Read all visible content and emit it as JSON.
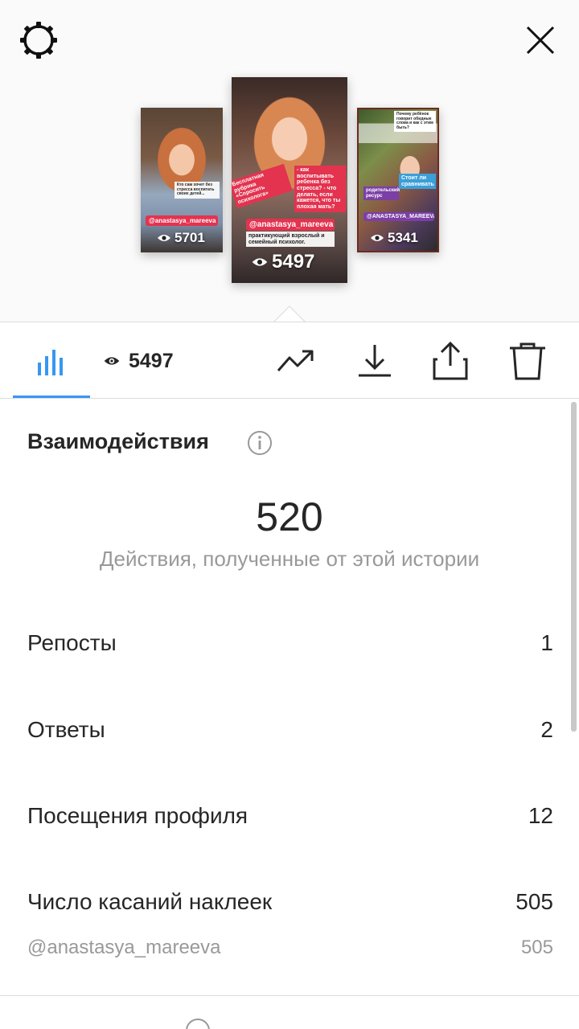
{
  "header": {
    "settings_icon": "settings-gear-icon",
    "close_icon": "close-icon"
  },
  "stories": [
    {
      "views": "5701",
      "handle": "@anastasya_mareeva",
      "caption": "Кто сам хочет без стресса воспитать своих детей..."
    },
    {
      "views": "5497",
      "handle": "@anastasya_mareeva",
      "rubric": "Бесплатная рубрика «Спросить психолога»",
      "questions": "- как воспитывать ребенка без стресса? - что делать, если кажется, что ты плохая мать?",
      "subtitle": "практикующий взрослый и семейный психолог."
    },
    {
      "views": "5341",
      "handle": "@ANASTASYA_MAREEVA",
      "headline": "Почему ребёнок говорит обидные слова и как с этим быть?",
      "resource": "родительский ресурс",
      "worth": "Стоит ли сравнивать"
    }
  ],
  "toolbar": {
    "views": "5497",
    "insights_icon": "bar-chart-icon",
    "eye_icon": "eye-icon",
    "trend_icon": "trending-up-icon",
    "download_icon": "download-icon",
    "share_icon": "share-icon",
    "delete_icon": "trash-icon"
  },
  "interactions": {
    "title": "Взаимодействия",
    "total": "520",
    "caption": "Действия, полученные от этой истории",
    "rows": [
      {
        "label": "Репосты",
        "value": "1"
      },
      {
        "label": "Ответы",
        "value": "2"
      },
      {
        "label": "Посещения профиля",
        "value": "12"
      },
      {
        "label": "Число касаний наклеек",
        "value": "505"
      }
    ],
    "sub_rows": [
      {
        "label": "@anastasya_mareeva",
        "value": "505"
      }
    ]
  },
  "colors": {
    "accent": "#3897f0",
    "text": "#262626",
    "muted": "#999999",
    "divider": "#dbdbdb"
  }
}
